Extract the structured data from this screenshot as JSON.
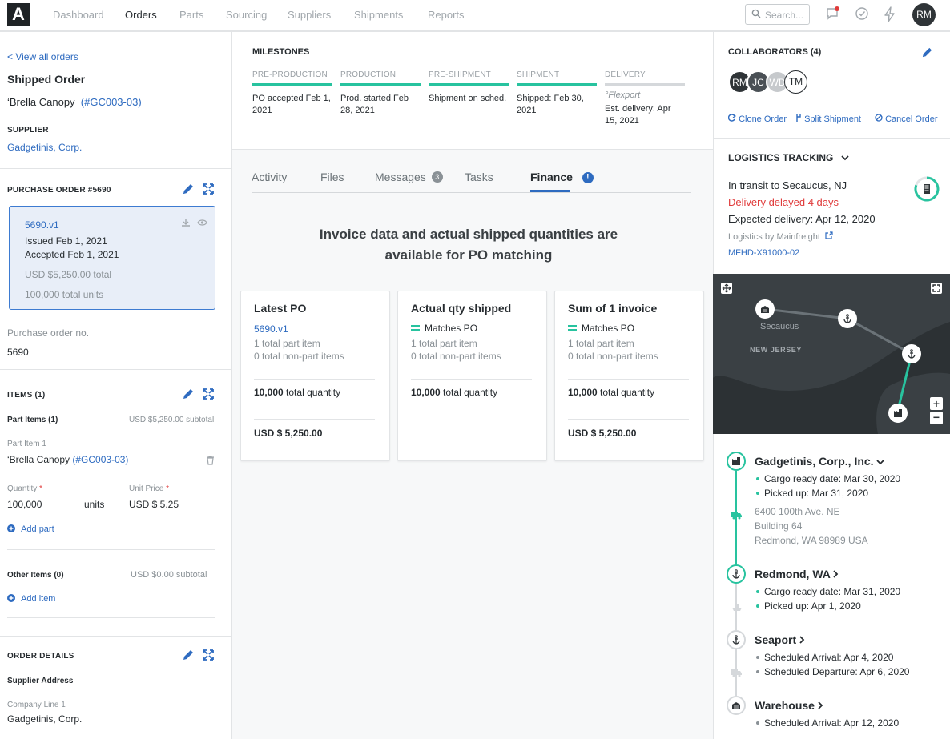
{
  "nav": {
    "logo": "A",
    "items": [
      "Dashboard",
      "Orders",
      "Parts",
      "Sourcing",
      "Suppliers",
      "Shipments",
      "Reports"
    ],
    "search_placeholder": "Search...",
    "user_initials": "RM"
  },
  "left": {
    "back_link": "< View all orders",
    "title": "Shipped Order",
    "product_name": "‘Brella Canopy",
    "product_code": "(#GC003-03)",
    "supplier_label": "SUPPLIER",
    "supplier_name": "Gadgetinis, Corp.",
    "po_header": "PURCHASE ORDER #5690",
    "po_version": "5690.v1",
    "po_issued": "Issued Feb 1, 2021",
    "po_accepted": "Accepted Feb 1, 2021",
    "po_total": "USD $5,250.00 total",
    "po_units": "100,000 total units",
    "po_no_label": "Purchase order no.",
    "po_no_value": "5690",
    "items_header": "ITEMS (1)",
    "part_items_label": "Part Items (1)",
    "part_items_subtotal": "USD $5,250.00 subtotal",
    "part_item_label": "Part Item 1",
    "part_item_name": "‘Brella Canopy",
    "part_item_code": "(#GC003-03)",
    "quantity_label": "Quantity",
    "quantity_value": "100,000",
    "quantity_unit": "units",
    "unit_price_label": "Unit Price",
    "unit_price_value": "USD $ 5.25",
    "add_part": "Add part",
    "other_items_label": "Other Items (0)",
    "other_items_subtotal": "USD $0.00 subtotal",
    "add_item": "Add item",
    "order_details_header": "ORDER DETAILS",
    "supplier_address_label": "Supplier Address",
    "company_line_label": "Company Line 1",
    "company_line_value": "Gadgetinis, Corp."
  },
  "milestones": {
    "header": "MILESTONES",
    "items": [
      {
        "label": "PRE-PRODUCTION",
        "text": "PO accepted Feb 1, 2021"
      },
      {
        "label": "PRODUCTION",
        "text": "Prod. started Feb 28, 2021"
      },
      {
        "label": "PRE-SHIPMENT",
        "text": "Shipment on sched."
      },
      {
        "label": "SHIPMENT",
        "text": "Shipped: Feb 30, 2021"
      },
      {
        "label": "DELIVERY",
        "sub": "Flexport",
        "text": "Est. delivery: Apr 15, 2021"
      }
    ]
  },
  "tabs": {
    "activity": "Activity",
    "files": "Files",
    "messages": "Messages",
    "messages_count": "3",
    "tasks": "Tasks",
    "finance": "Finance",
    "finance_badge": "!"
  },
  "finance": {
    "heading_line1": "Invoice data and actual shipped quantities are",
    "heading_line2": "available for PO matching",
    "cards": [
      {
        "title": "Latest PO",
        "link": "5690.v1",
        "line1": "1 total part item",
        "line2": "0 total non-part items",
        "qty": "10,000",
        "qty_suffix": "total quantity",
        "price": "USD $ 5,250.00"
      },
      {
        "title": "Actual qty shipped",
        "match": "Matches PO",
        "line1": "1 total part item",
        "line2": "0 total non-part items",
        "qty": "10,000",
        "qty_suffix": "total quantity"
      },
      {
        "title": "Sum of 1 invoice",
        "match": "Matches PO",
        "line1": "1 total part item",
        "line2": "0 total non-part items",
        "qty": "10,000",
        "qty_suffix": "total quantity",
        "price": "USD $ 5,250.00"
      }
    ]
  },
  "right": {
    "collab_header": "COLLABORATORS (4)",
    "collaborators": [
      "RM",
      "JC",
      "WD",
      "TM"
    ],
    "clone": "Clone Order",
    "split": "Split Shipment",
    "cancel": "Cancel Order",
    "logistics_header": "LOGISTICS TRACKING",
    "transit": "In transit to Secaucus, NJ",
    "delayed": "Delivery delayed 4 days",
    "expected": "Expected delivery: Apr 12, 2020",
    "logistics_by": "Logistics by Mainfreight",
    "tracking_no": "MFHD-X91000-02",
    "map_city": "Secaucus",
    "map_state": "NEW JERSEY",
    "timeline": [
      {
        "title": "Gadgetinis, Corp., Inc.",
        "bullets": [
          "Cargo ready date: Mar 30, 2020",
          "Picked up: Mar 31, 2020"
        ],
        "address": [
          "6400 100th Ave. NE",
          "Building 64",
          "Redmond, WA 98989 USA"
        ]
      },
      {
        "title": "Redmond, WA",
        "bullets": [
          "Cargo ready date: Mar 31, 2020",
          "Picked up: Apr 1, 2020"
        ]
      },
      {
        "title": "Seaport",
        "bullets": [
          "Scheduled Arrival: Apr 4, 2020",
          "Scheduled Departure: Apr 6, 2020"
        ]
      },
      {
        "title": "Warehouse",
        "bullets": [
          "Scheduled Arrival: Apr 12, 2020"
        ]
      }
    ]
  },
  "colors": {
    "accent": "#28c39f",
    "link": "#2e6bc0",
    "danger": "#e03b3b",
    "map_bg": "#2c3134"
  }
}
